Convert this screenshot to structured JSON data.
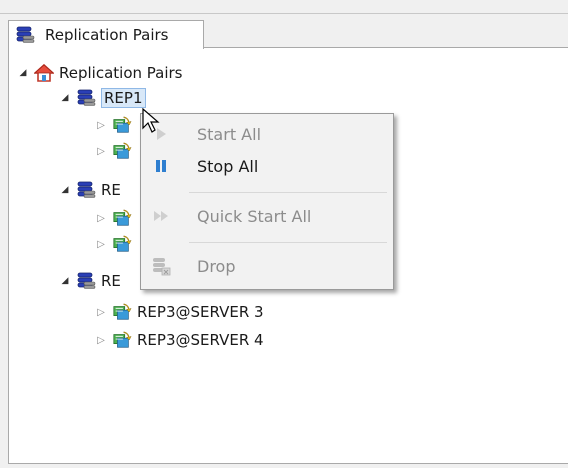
{
  "tab": {
    "label": "Replication Pairs"
  },
  "tree": {
    "root": "Replication Pairs",
    "rep1": "REP1",
    "rep2_partial": "RE",
    "rep3_partial": "RE",
    "rep3_children": [
      "REP3@SERVER 3",
      "REP3@SERVER 4"
    ]
  },
  "context_menu": {
    "items": [
      {
        "label": "Start All",
        "enabled": false,
        "icon": "play-icon"
      },
      {
        "label": "Stop All",
        "enabled": true,
        "icon": "pause-icon"
      },
      {
        "label": "Quick Start All",
        "enabled": false,
        "icon": "fast-forward-icon"
      },
      {
        "label": "Drop",
        "enabled": false,
        "icon": "drop-database-icon"
      }
    ]
  },
  "colors": {
    "selection": "#d8e8f8",
    "menu_bg": "#f2f2f2",
    "pause_blue": "#2f7fd0"
  }
}
